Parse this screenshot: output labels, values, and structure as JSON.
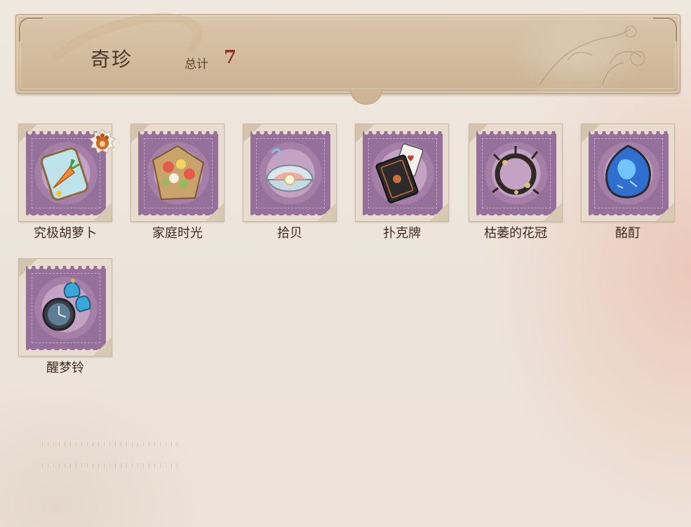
{
  "header": {
    "title": "奇珍",
    "total_label": "总计",
    "total_value": "7"
  },
  "items": [
    {
      "label": "究极胡萝卜",
      "icon": "carrot-jar-icon",
      "has_badge": true,
      "badge_icon": "paw-badge-icon"
    },
    {
      "label": "家庭时光",
      "icon": "flower-bouquet-icon"
    },
    {
      "label": "拾贝",
      "icon": "pearl-shell-icon"
    },
    {
      "label": "扑克牌",
      "icon": "playing-cards-icon"
    },
    {
      "label": "枯萎的花冠",
      "icon": "withered-wreath-icon"
    },
    {
      "label": "酩酊",
      "icon": "blue-gem-icon"
    },
    {
      "label": "醒梦铃",
      "icon": "alarm-clock-bell-icon"
    }
  ],
  "colors": {
    "title": "#4b3526",
    "total_value": "#9c2e25",
    "stamp_purple": "#8f6a94"
  }
}
